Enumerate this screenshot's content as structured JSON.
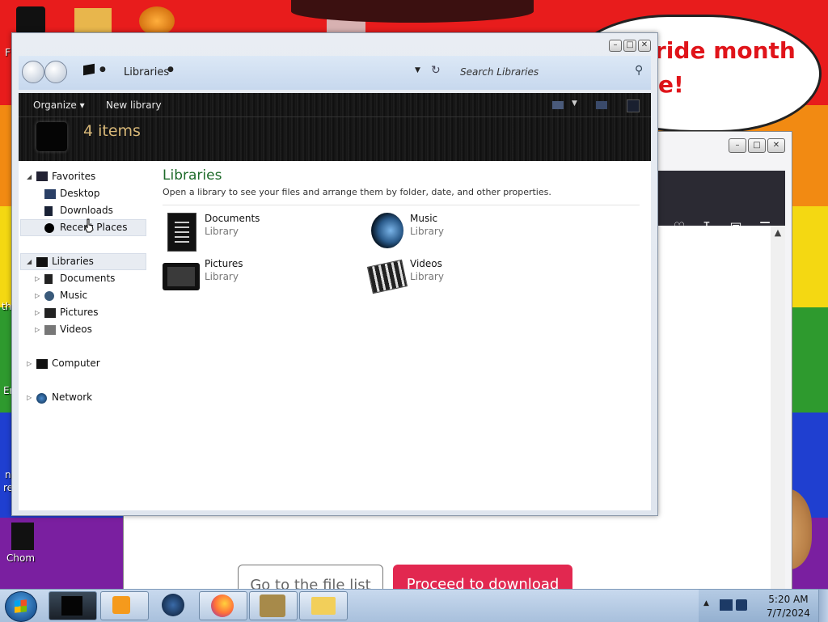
{
  "desktop": {
    "banner_line1": "ride month",
    "banner_line2": "e!",
    "edge_labels": [
      "F",
      "th",
      "Er",
      "n",
      "re"
    ],
    "chrome_label": "Chom"
  },
  "explorer": {
    "breadcrumb": "Libraries",
    "search_placeholder": "Search Libraries",
    "toolbar": {
      "organize": "Organize",
      "new_library": "New library",
      "items_count": "4 items"
    },
    "nav": {
      "favorites": "Favorites",
      "favorites_items": [
        "Desktop",
        "Downloads",
        "Recent Places"
      ],
      "libraries": "Libraries",
      "libraries_items": [
        "Documents",
        "Music",
        "Pictures",
        "Videos"
      ],
      "computer": "Computer",
      "network": "Network"
    },
    "main": {
      "title": "Libraries",
      "subtitle": "Open a library to see your files and arrange them by folder, date, and other properties.",
      "libraries": [
        {
          "name": "Documents",
          "kind": "Library",
          "icon": "documents-icon"
        },
        {
          "name": "Music",
          "kind": "Library",
          "icon": "music-icon"
        },
        {
          "name": "Pictures",
          "kind": "Library",
          "icon": "pictures-icon"
        },
        {
          "name": "Videos",
          "kind": "Library",
          "icon": "videos-icon"
        }
      ]
    }
  },
  "browser": {
    "button_file_list": "Go to the file list",
    "button_download": "Proceed to download"
  },
  "taskbar": {
    "time": "5:20 AM",
    "date": "7/7/2024"
  },
  "colors": {
    "library_title": "#1e6b2a",
    "download_button": "#e22850",
    "items_count": "#d8b878"
  }
}
